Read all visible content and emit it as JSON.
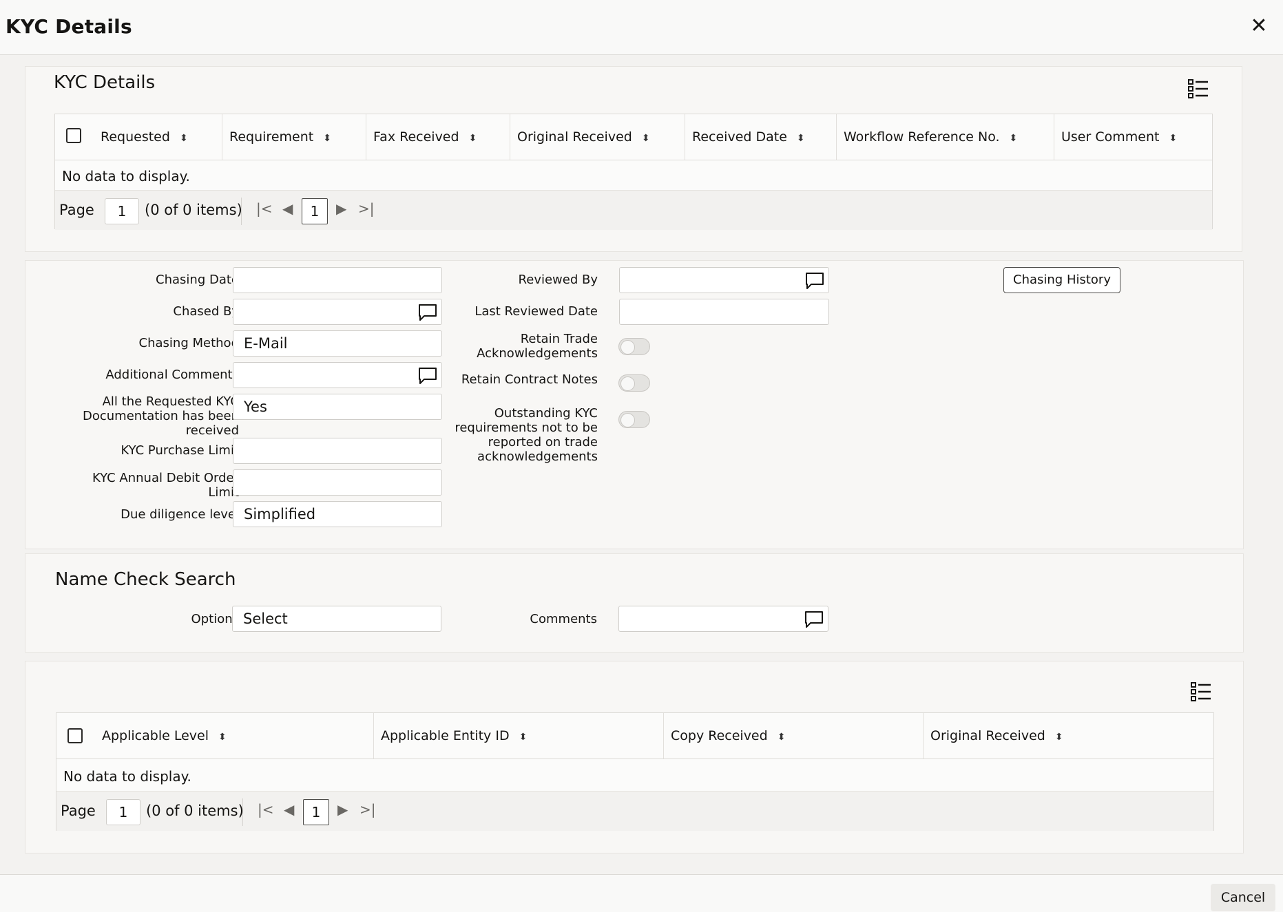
{
  "window": {
    "title": "KYC Details",
    "close_glyph": "✕"
  },
  "kyc_table": {
    "section_title": "KYC Details",
    "columns": [
      "Requested",
      "Requirement",
      "Fax Received",
      "Original Received",
      "Received Date",
      "Workflow Reference No.",
      "User Comment"
    ],
    "empty_text": "No data to display.",
    "pager": {
      "label": "Page",
      "page": "1",
      "count": "(0 of 0 items)",
      "current": "1"
    }
  },
  "form": {
    "chasing_date": {
      "label": "Chasing Date",
      "value": ""
    },
    "chased_by": {
      "label": "Chased By",
      "value": ""
    },
    "chasing_method": {
      "label": "Chasing Method",
      "value": "E-Mail"
    },
    "additional_comments": {
      "label": "Additional Comments",
      "value": ""
    },
    "all_received": {
      "label": "All the Requested KYC Documentation has been received",
      "value": "Yes"
    },
    "purchase_limit": {
      "label": "KYC Purchase Limit",
      "value": ""
    },
    "annual_debit_limit": {
      "label": "KYC Annual Debit Order Limit",
      "value": ""
    },
    "due_diligence": {
      "label": "Due diligence level",
      "value": "Simplified"
    },
    "reviewed_by": {
      "label": "Reviewed By",
      "value": ""
    },
    "last_reviewed_date": {
      "label": "Last Reviewed Date",
      "value": ""
    },
    "retain_trade_ack": {
      "label": "Retain Trade Acknowledgements",
      "on": false
    },
    "retain_contract_notes": {
      "label": "Retain Contract Notes",
      "on": false
    },
    "outstanding_kyc": {
      "label": "Outstanding KYC requirements not to be reported on trade acknowledgements",
      "on": false
    },
    "chasing_history_button": "Chasing History"
  },
  "name_check": {
    "section_title": "Name Check Search",
    "options": {
      "label": "Options",
      "value": "Select"
    },
    "comments": {
      "label": "Comments",
      "value": ""
    }
  },
  "entity_table": {
    "columns": [
      "Applicable Level",
      "Applicable Entity ID",
      "Copy Received",
      "Original Received"
    ],
    "empty_text": "No data to display.",
    "pager": {
      "label": "Page",
      "page": "1",
      "count": "(0 of 0 items)",
      "current": "1"
    }
  },
  "footer": {
    "cancel_label": "Cancel"
  },
  "icons": {
    "sort": "sort-icon",
    "lov": "chat-bubble-icon",
    "grid": "column-list-icon"
  }
}
